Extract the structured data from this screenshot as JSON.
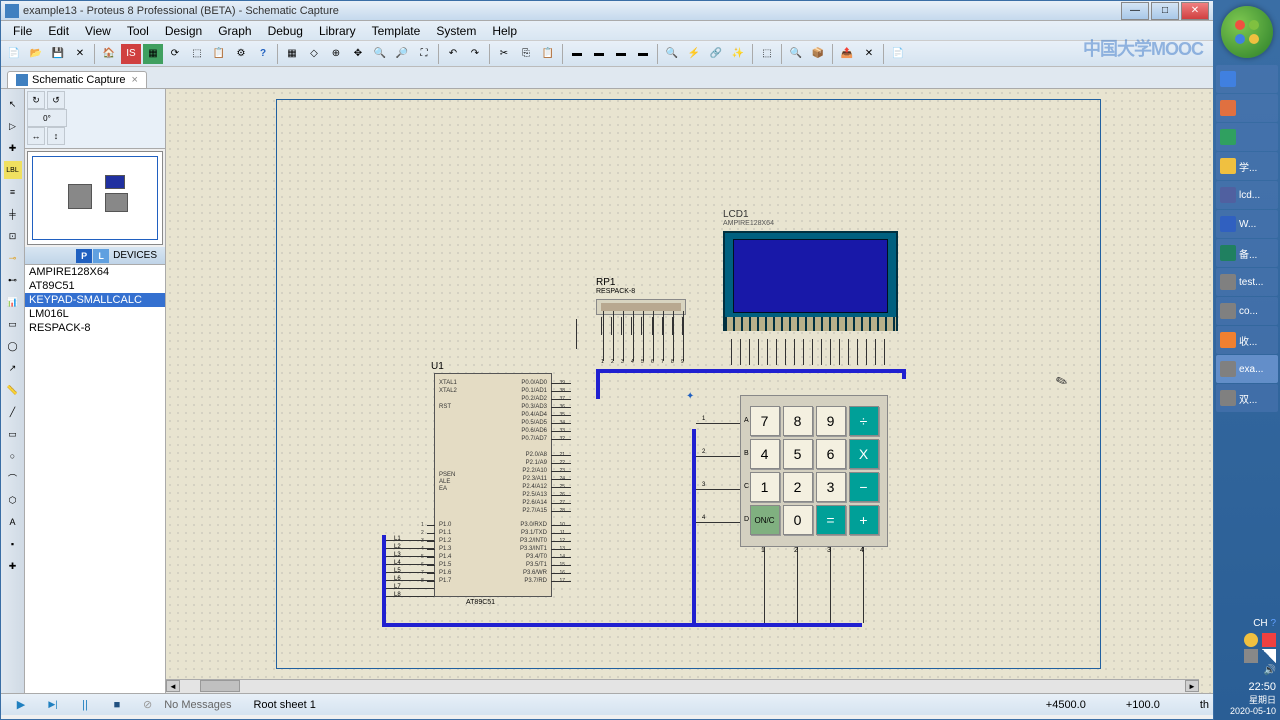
{
  "title": "example13 - Proteus 8 Professional (BETA) - Schematic Capture",
  "menu": [
    "File",
    "Edit",
    "View",
    "Tool",
    "Design",
    "Graph",
    "Debug",
    "Library",
    "Template",
    "System",
    "Help"
  ],
  "tab": {
    "label": "Schematic Capture",
    "close": "×"
  },
  "devices": {
    "header": "DEVICES",
    "p": "P",
    "l": "L",
    "items": [
      "AMPIRE128X64",
      "AT89C51",
      "KEYPAD-SMALLCALC",
      "LM016L",
      "RESPACK-8"
    ],
    "selected": 2
  },
  "lcd": {
    "ref": "LCD1",
    "part": "AMPIRE128X64"
  },
  "rp": {
    "ref": "RP1",
    "part": "RESPACK-8"
  },
  "mcu": {
    "ref": "U1",
    "part": "AT89C51",
    "left_top": [
      "XTAL1",
      "XTAL2",
      "",
      "RST"
    ],
    "left_mid": [
      "PSEN",
      "ALE",
      "EA"
    ],
    "left_bot": [
      "P1.0",
      "P1.1",
      "P1.2",
      "P1.3",
      "P1.4",
      "P1.5",
      "P1.6",
      "P1.7"
    ],
    "right_top": [
      "P0.0/AD0",
      "P0.1/AD1",
      "P0.2/AD2",
      "P0.3/AD3",
      "P0.4/AD4",
      "P0.5/AD5",
      "P0.6/AD6",
      "P0.7/AD7"
    ],
    "right_mid": [
      "P2.0/A8",
      "P2.1/A9",
      "P2.2/A10",
      "P2.3/A11",
      "P2.4/A12",
      "P2.5/A13",
      "P2.6/A14",
      "P2.7/A15"
    ],
    "right_bot": [
      "P3.0/RXD",
      "P3.1/TXD",
      "P3.2/INT0",
      "P3.3/INT1",
      "P3.4/T0",
      "P3.5/T1",
      "P3.6/WR",
      "P3.7/RD"
    ]
  },
  "keypad": {
    "keys": [
      {
        "t": "7"
      },
      {
        "t": "8"
      },
      {
        "t": "9"
      },
      {
        "t": "÷",
        "op": true
      },
      {
        "t": "4"
      },
      {
        "t": "5"
      },
      {
        "t": "6"
      },
      {
        "t": "X",
        "op": true
      },
      {
        "t": "1"
      },
      {
        "t": "2"
      },
      {
        "t": "3"
      },
      {
        "t": "−",
        "op": true
      },
      {
        "t": "ON/C",
        "onc": true
      },
      {
        "t": "0"
      },
      {
        "t": "=",
        "op": true
      },
      {
        "t": "+",
        "op": true
      }
    ]
  },
  "status": {
    "msg_icon": "⊘",
    "msg": "No Messages",
    "sheet": "Root sheet 1",
    "x": "+4500.0",
    "y": "+100.0",
    "unit": "th"
  },
  "play": {
    "play": "▶",
    "step": "▶|",
    "pause": "||",
    "stop": "■"
  },
  "taskbar": {
    "items": [
      {
        "t": "",
        "c": "#4080e0"
      },
      {
        "t": "",
        "c": "#e07040"
      },
      {
        "t": "",
        "c": "#30a060"
      },
      {
        "t": "学...",
        "c": "#f0c040"
      },
      {
        "t": "lcd...",
        "c": "#5060a0"
      },
      {
        "t": "W...",
        "c": "#3060c0"
      },
      {
        "t": "备...",
        "c": "#208060"
      },
      {
        "t": "test...",
        "c": "#808080"
      },
      {
        "t": "co...",
        "c": "#808080"
      },
      {
        "t": "收...",
        "c": "#f08030"
      },
      {
        "t": "exa...",
        "c": "#808080",
        "sel": true
      },
      {
        "t": "双...",
        "c": "#808080"
      }
    ],
    "ch": "CH",
    "time": "22:50",
    "day": "星期日",
    "date": "2020-05-10"
  },
  "mooc": "中国大学MOOC",
  "wire_labels": [
    "L1",
    "L2",
    "L3",
    "L4",
    "L5",
    "L6",
    "L7",
    "L8"
  ],
  "kp_row_labels": [
    "A",
    "B",
    "C",
    "D"
  ],
  "kp_col_labels": [
    "1",
    "2",
    "3",
    "4"
  ]
}
